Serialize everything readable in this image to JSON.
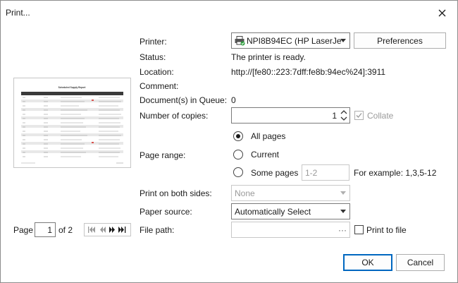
{
  "window": {
    "title": "Print..."
  },
  "labels": {
    "printer": "Printer:",
    "status": "Status:",
    "location": "Location:",
    "comment": "Comment:",
    "queue": "Document(s) in Queue:",
    "copies": "Number of copies:",
    "page_range": "Page range:",
    "both_sides": "Print on both sides:",
    "paper_source": "Paper source:",
    "file_path": "File path:"
  },
  "printer": {
    "selected": "NPI8B94EC (HP LaserJe",
    "preferences_label": "Preferences",
    "status": "The printer is ready.",
    "location": "http://[fe80::223:7dff:fe8b:94ec%24]:3911",
    "comment": "",
    "queue_count": "0"
  },
  "copies": {
    "value": "1",
    "collate_label": "Collate"
  },
  "page_range": {
    "all_pages": "All pages",
    "current": "Current",
    "some_pages": "Some pages",
    "some_pages_value": "1-2",
    "example": "For example: 1,3,5-12"
  },
  "both_sides": {
    "value": "None"
  },
  "paper_source": {
    "value": "Automatically Select"
  },
  "file_path": {
    "value": "",
    "browse_label": "···",
    "print_to_file_label": "Print to file"
  },
  "preview": {
    "page_label": "Page",
    "page_number": "1",
    "page_total": "of 2",
    "doc_title": "Scheduled Supply Report"
  },
  "footer": {
    "ok_label": "OK",
    "cancel_label": "Cancel"
  }
}
